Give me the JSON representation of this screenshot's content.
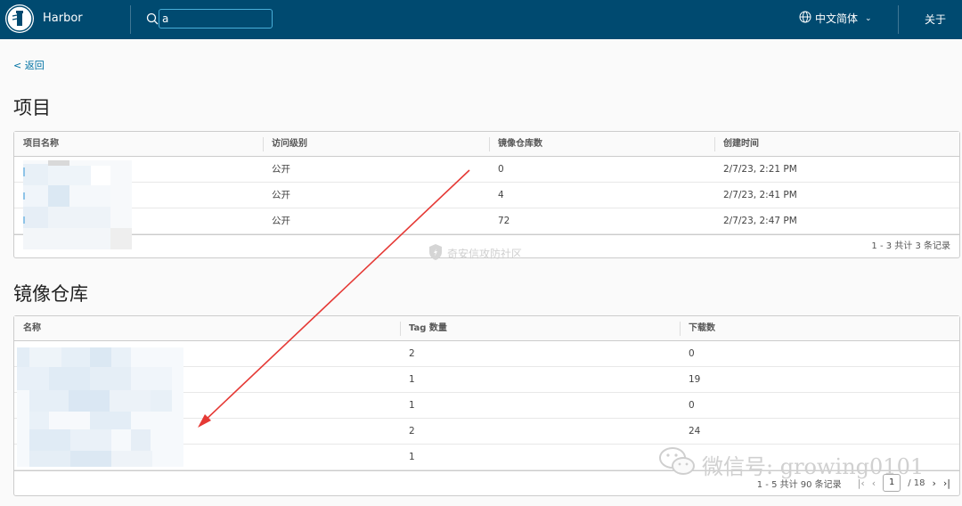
{
  "header": {
    "app_name": "Harbor",
    "search_value": "a",
    "language": "中文简体",
    "about": "关于"
  },
  "nav": {
    "back": "< 返回"
  },
  "projects": {
    "title": "项目",
    "columns": [
      "项目名称",
      "访问级别",
      "镜像仓库数",
      "创建时间"
    ],
    "rows": [
      {
        "access": "公开",
        "repo_count": "0",
        "created": "2/7/23, 2:21 PM"
      },
      {
        "access": "公开",
        "repo_count": "4",
        "created": "2/7/23, 2:41 PM"
      },
      {
        "access": "公开",
        "repo_count": "72",
        "created": "2/7/23, 2:47 PM"
      }
    ],
    "footer": "1 - 3 共计 3 条记录"
  },
  "repositories": {
    "title": "镜像仓库",
    "columns": [
      "名称",
      "Tag 数量",
      "下载数"
    ],
    "rows": [
      {
        "tags": "2",
        "downloads": "0"
      },
      {
        "tags": "1",
        "downloads": "19"
      },
      {
        "tags": "1",
        "downloads": "0"
      },
      {
        "tags": "2",
        "downloads": "24"
      },
      {
        "tags": "1",
        "downloads": ""
      }
    ],
    "footer": "1 - 5 共计 90 条记录",
    "page_current": "1",
    "page_total": "/ 18"
  },
  "overlays": {
    "watermark": "奇安信攻防社区",
    "wechat": "微信号: growing0101"
  },
  "colors": {
    "header_bg": "#004a70",
    "link": "#0072a3",
    "arrow": "#e53935"
  }
}
